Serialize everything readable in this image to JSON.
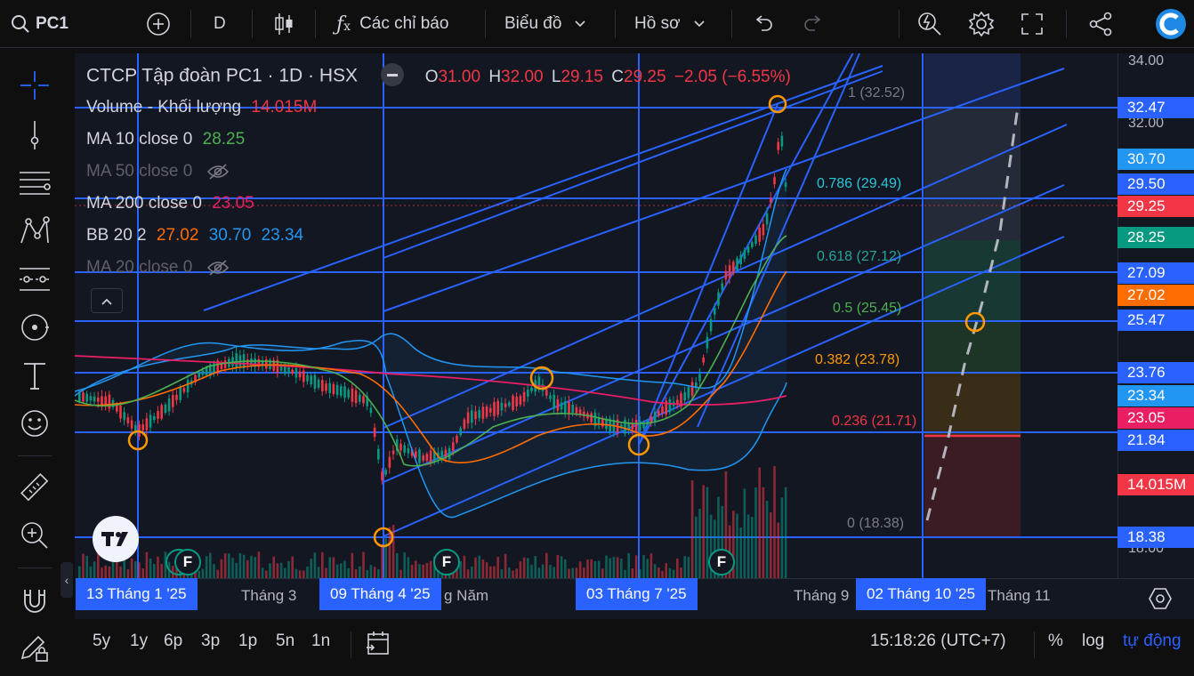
{
  "topbar": {
    "symbol": "PC1",
    "interval": "D",
    "indicators_label": "Các chỉ báo",
    "chart_label": "Biểu đồ",
    "profile_label": "Hồ sơ"
  },
  "legend": {
    "title": "CTCP Tập đoàn PC1 · 1D · HSX",
    "ohlc": {
      "o_label": "O",
      "o": "31.00",
      "h_label": "H",
      "h": "32.00",
      "l_label": "L",
      "l": "29.15",
      "c_label": "C",
      "c": "29.25",
      "change": "−2.05 (−6.55%)"
    },
    "volume": {
      "label": "Volume - Khối lượng",
      "value": "14.015M"
    },
    "ma10": {
      "label": "MA 10 close 0",
      "value": "28.25"
    },
    "ma50": {
      "label": "MA 50 close 0"
    },
    "ma200": {
      "label": "MA 200 close 0",
      "value": "23.05"
    },
    "bb": {
      "label": "BB 20 2",
      "v1": "27.02",
      "v2": "30.70",
      "v3": "23.34"
    },
    "ma20": {
      "label": "MA 20 close 0"
    }
  },
  "fib_levels": [
    {
      "text": "1 (32.52)",
      "color": "#787b86"
    },
    {
      "text": "0.786 (29.49)",
      "color": "#26c6da"
    },
    {
      "text": "0.618 (27.12)",
      "color": "#26a69a"
    },
    {
      "text": "0.5 (25.45)",
      "color": "#4caf50"
    },
    {
      "text": "0.382 (23.78)",
      "color": "#ff9800"
    },
    {
      "text": "0.236 (21.71)",
      "color": "#f23645"
    },
    {
      "text": "0 (18.38)",
      "color": "#787b86"
    }
  ],
  "price_ticks": [
    "34.00",
    "32.00",
    "18.00"
  ],
  "price_labels": [
    {
      "text": "32.47",
      "color": "#2962ff"
    },
    {
      "text": "30.70",
      "color": "#2196f3"
    },
    {
      "text": "29.50",
      "color": "#2962ff"
    },
    {
      "text": "29.25",
      "color": "#f23645"
    },
    {
      "text": "28.25",
      "color": "#089981"
    },
    {
      "text": "27.09",
      "color": "#2962ff"
    },
    {
      "text": "27.02",
      "color": "#ff6d00"
    },
    {
      "text": "25.47",
      "color": "#2962ff"
    },
    {
      "text": "23.76",
      "color": "#2962ff"
    },
    {
      "text": "23.34",
      "color": "#2196f3"
    },
    {
      "text": "23.05",
      "color": "#e91e63"
    },
    {
      "text": "21.84",
      "color": "#2962ff"
    },
    {
      "text": "14.015M",
      "color": "#f23645"
    },
    {
      "text": "18.38",
      "color": "#2962ff"
    }
  ],
  "time_axis": {
    "labels": [
      "Tháng 3",
      "g Năm",
      "Tháng 9",
      "Tháng 11"
    ],
    "boxes": [
      "13 Tháng 1 '25",
      "09 Tháng 4 '25",
      "03 Tháng 7 '25",
      "02 Tháng 10 '25"
    ]
  },
  "events": [
    "F",
    "F",
    "F"
  ],
  "bottombar": {
    "ranges": [
      "5y",
      "1y",
      "6p",
      "3p",
      "1p",
      "5n",
      "1n"
    ],
    "time": "15:18:26 (UTC+7)",
    "percent": "%",
    "log": "log",
    "auto": "tự động"
  },
  "colors": {
    "up": "#089981",
    "down": "#f23645",
    "accent": "#2962ff",
    "bg": "#131722"
  }
}
